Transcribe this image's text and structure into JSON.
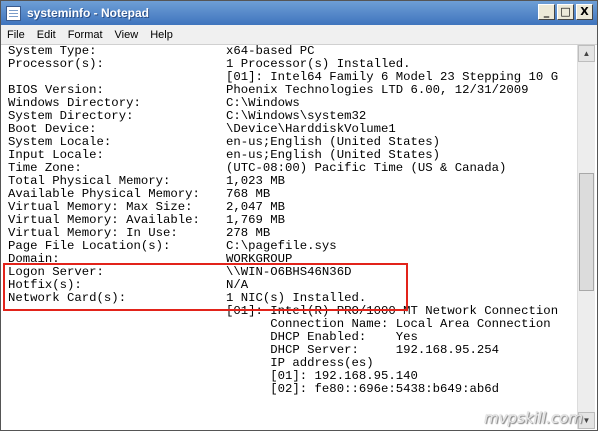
{
  "window": {
    "title": "systeminfo - Notepad"
  },
  "caption_buttons": {
    "minimize": "_",
    "maximize": "□",
    "close": "X"
  },
  "menu": [
    "File",
    "Edit",
    "Format",
    "View",
    "Help"
  ],
  "content": {
    "rows": [
      {
        "label": "System Type:",
        "value": "x64-based PC"
      },
      {
        "label": "Processor(s):",
        "value": "1 Processor(s) Installed."
      },
      {
        "label": "",
        "value": "[01]: Intel64 Family 6 Model 23 Stepping 10 G"
      },
      {
        "label": "BIOS Version:",
        "value": "Phoenix Technologies LTD 6.00, 12/31/2009"
      },
      {
        "label": "Windows Directory:",
        "value": "C:\\Windows"
      },
      {
        "label": "System Directory:",
        "value": "C:\\Windows\\system32"
      },
      {
        "label": "Boot Device:",
        "value": "\\Device\\HarddiskVolume1"
      },
      {
        "label": "System Locale:",
        "value": "en-us;English (United States)"
      },
      {
        "label": "Input Locale:",
        "value": "en-us;English (United States)"
      },
      {
        "label": "Time Zone:",
        "value": "(UTC-08:00) Pacific Time (US & Canada)"
      },
      {
        "label": "Total Physical Memory:",
        "value": "1,023 MB"
      },
      {
        "label": "Available Physical Memory:",
        "value": "768 MB"
      },
      {
        "label": "Virtual Memory: Max Size:",
        "value": "2,047 MB"
      },
      {
        "label": "Virtual Memory: Available:",
        "value": "1,769 MB"
      },
      {
        "label": "Virtual Memory: In Use:",
        "value": "278 MB"
      },
      {
        "label": "Page File Location(s):",
        "value": "C:\\pagefile.sys"
      },
      {
        "label": "Domain:",
        "value": "WORKGROUP"
      },
      {
        "label": "Logon Server:",
        "value": "\\\\WIN-O6BHS46N36D"
      },
      {
        "label": "Hotfix(s):",
        "value": "N/A"
      },
      {
        "label": "Network Card(s):",
        "value": "1 NIC(s) Installed."
      },
      {
        "label": "",
        "value": "[01]: Intel(R) PRO/1000 MT Network Connection"
      },
      {
        "label": "",
        "value": "      Connection Name: Local Area Connection"
      },
      {
        "label": "",
        "value": "      DHCP Enabled:    Yes"
      },
      {
        "label": "",
        "value": "      DHCP Server:     192.168.95.254"
      },
      {
        "label": "",
        "value": "      IP address(es)"
      },
      {
        "label": "",
        "value": "      [01]: 192.168.95.140"
      },
      {
        "label": "",
        "value": "      [02]: fe80::696e:5438:b649:ab6d"
      }
    ]
  },
  "watermark": "mvpskill.com"
}
